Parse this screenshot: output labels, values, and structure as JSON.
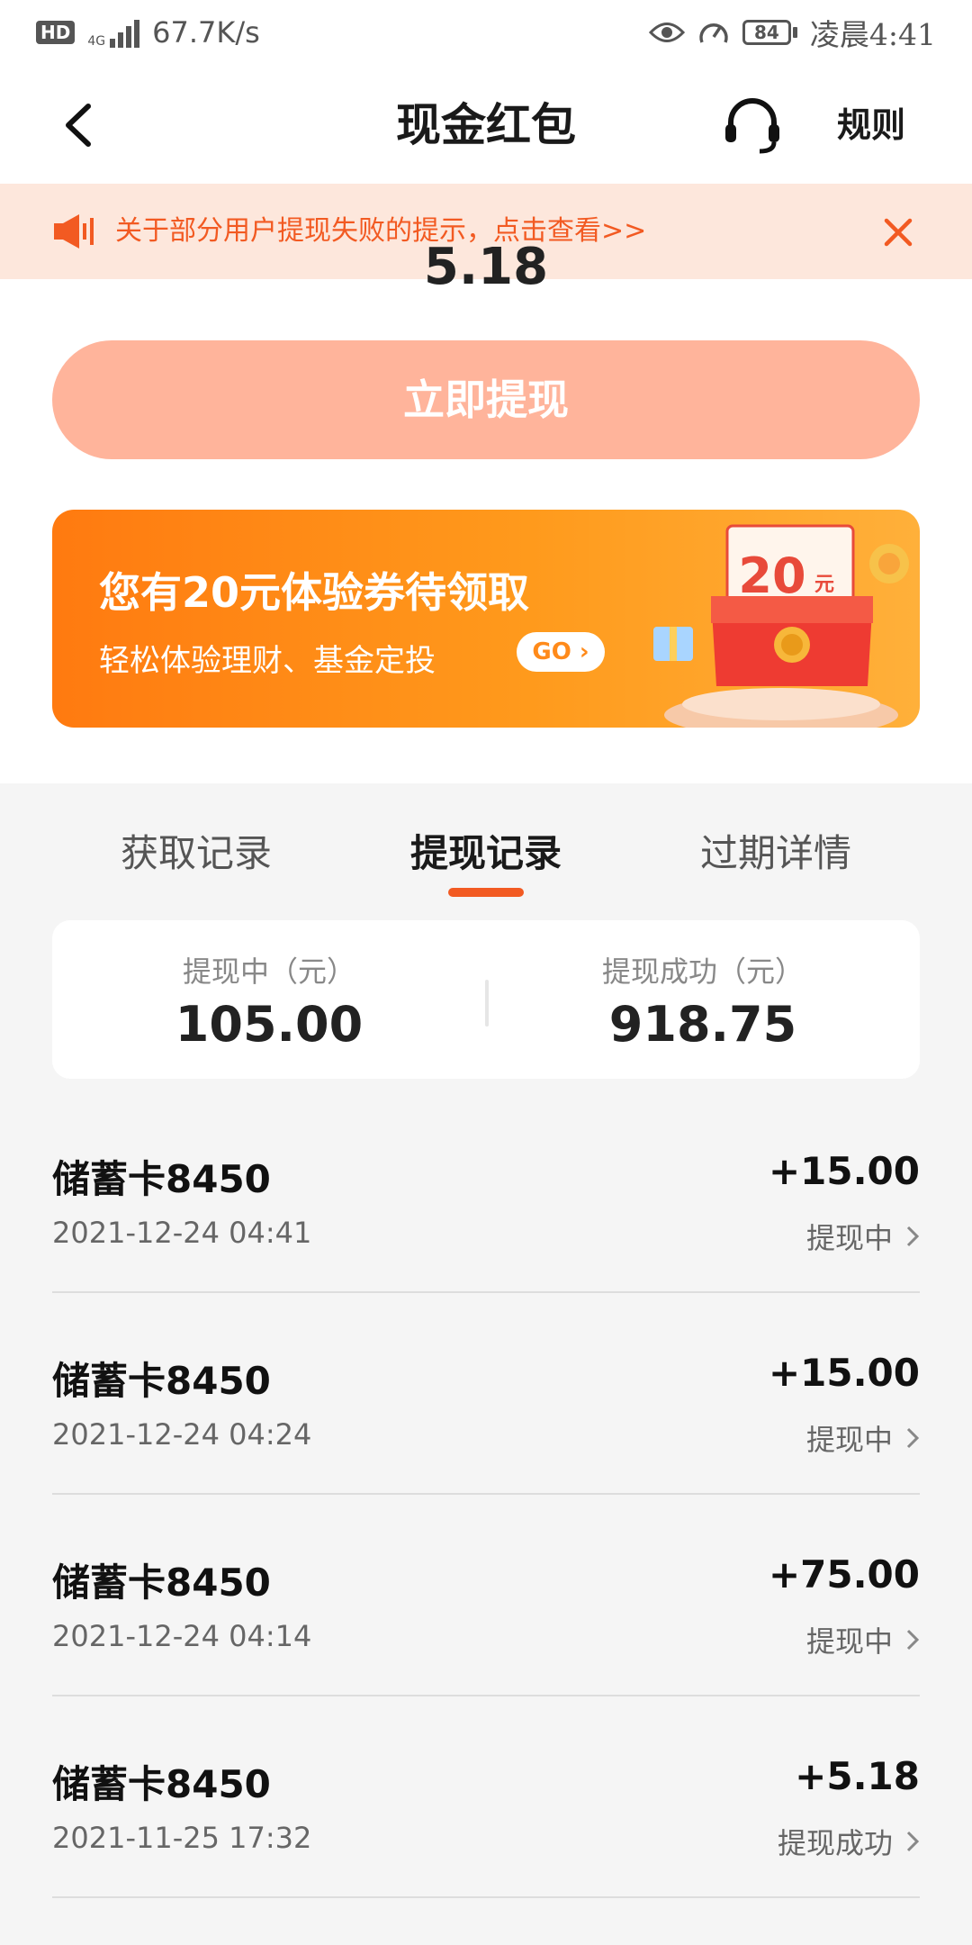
{
  "status_bar": {
    "hd": "HD",
    "network": "4G",
    "speed": "67.7K/s",
    "battery": "84",
    "time": "凌晨4:41"
  },
  "header": {
    "title": "现金红包",
    "rules": "规则"
  },
  "notice": {
    "text": "关于部分用户提现失败的提示，点击查看>>"
  },
  "top": {
    "amount_peek": "5.18",
    "withdraw_button": "立即提现"
  },
  "promo": {
    "title": "您有20元体验券待领取",
    "subtitle": "轻松体验理财、基金定投",
    "go": "GO",
    "coupon_value": "20",
    "coupon_unit": "元"
  },
  "tabs": [
    {
      "label": "获取记录",
      "active": false
    },
    {
      "label": "提现记录",
      "active": true
    },
    {
      "label": "过期详情",
      "active": false
    }
  ],
  "summary": {
    "pending_label": "提现中（元）",
    "pending_value": "105.00",
    "success_label": "提现成功（元）",
    "success_value": "918.75"
  },
  "records": [
    {
      "name": "储蓄卡8450",
      "date": "2021-12-24 04:41",
      "amount": "+15.00",
      "status": "提现中"
    },
    {
      "name": "储蓄卡8450",
      "date": "2021-12-24 04:24",
      "amount": "+15.00",
      "status": "提现中"
    },
    {
      "name": "储蓄卡8450",
      "date": "2021-12-24 04:14",
      "amount": "+75.00",
      "status": "提现中"
    },
    {
      "name": "储蓄卡8450",
      "date": "2021-11-25 17:32",
      "amount": "+5.18",
      "status": "提现成功"
    }
  ],
  "colors": {
    "accent": "#f25a22",
    "button": "#ffb49b",
    "notice_bg": "#fde7dc",
    "promo": "#ff8a1a"
  }
}
